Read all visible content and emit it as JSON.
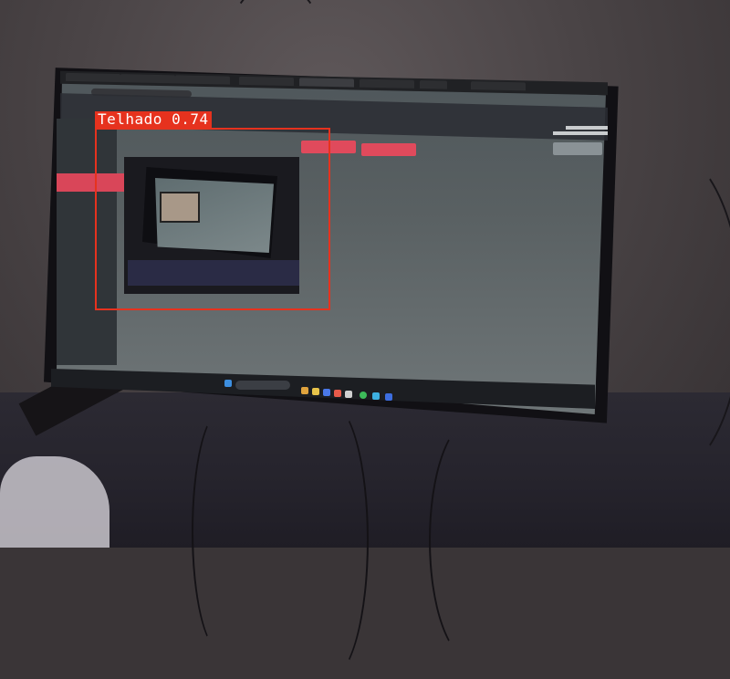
{
  "detection": {
    "label": "Telhado",
    "confidence": "0.74",
    "color": "#e6321e"
  },
  "scene": {
    "monitor_icon": "monitor-icon",
    "webcam_feed_icon": "camera-icon"
  }
}
